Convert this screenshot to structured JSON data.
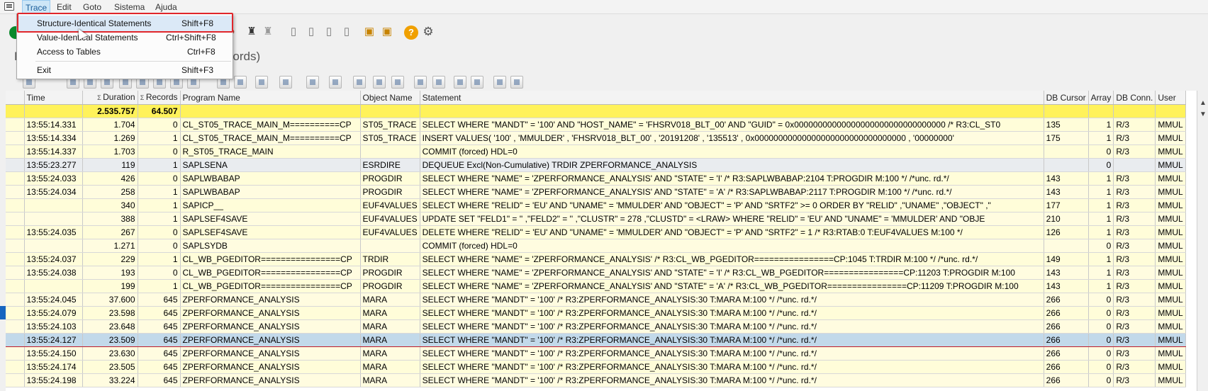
{
  "menubar": {
    "items": [
      "Trace",
      "Edit",
      "Goto",
      "Sistema",
      "Ajuda"
    ]
  },
  "dropdown": {
    "items": [
      {
        "label": "Structure-Identical Statements",
        "shortcut": "Shift+F8"
      },
      {
        "label": "Value-Identical Statements",
        "shortcut": "Ctrl+Shift+F8"
      },
      {
        "label": "Access to Tables",
        "shortcut": "Ctrl+F8"
      },
      {
        "label": "Exit",
        "shortcut": "Shift+F3"
      }
    ]
  },
  "page": {
    "subtitle_left": "P",
    "subtitle_right": "n Records)"
  },
  "toolbar": {
    "help_label": "?"
  },
  "grid": {
    "columns": [
      "Time",
      "Duration",
      "Records",
      "Program Name",
      "Object Name",
      "Statement",
      "DB Cursor",
      "Array",
      "DB Conn.",
      "User"
    ],
    "totals": {
      "duration": "2.535.757",
      "records": "64.507"
    },
    "rows": [
      {
        "time": "13:55:14.331",
        "duration": "1.704",
        "records": "0",
        "program": "CL_ST05_TRACE_MAIN_M==========CP",
        "object": "ST05_TRACE",
        "statement": "SELECT  WHERE \"MANDT\" = '100' AND \"HOST_NAME\" = 'FHSRV018_BLT_00' AND \"GUID\" = 0x00000000000000000000000000000000   /* R3:CL_ST0",
        "cursor": "135",
        "array": "1",
        "conn": "R/3",
        "user": "MMUL"
      },
      {
        "time": "13:55:14.334",
        "duration": "1.269",
        "records": "1",
        "program": "CL_ST05_TRACE_MAIN_M==========CP",
        "object": "ST05_TRACE",
        "statement": "INSERT  VALUES( '100' , 'MMULDER' , 'FHSRV018_BLT_00' , '20191208' , '135513' , 0x00000000000000000000000000000000 , '00000000'",
        "cursor": "175",
        "array": "1",
        "conn": "R/3",
        "user": "MMUL"
      },
      {
        "time": "13:55:14.337",
        "duration": "1.703",
        "records": "0",
        "program": "R_ST05_TRACE_MAIN",
        "object": "",
        "statement": "COMMIT (forced) HDL=0",
        "cursor": "",
        "array": "0",
        "conn": "R/3",
        "user": "MMUL"
      },
      {
        "time": "13:55:23.277",
        "duration": "119",
        "records": "1",
        "program": "SAPLSENA",
        "object": "ESRDIRE",
        "statement": "DEQUEUE Excl(Non-Cumulative) TRDIR ZPERFORMANCE_ANALYSIS",
        "cursor": "",
        "array": "0",
        "conn": "",
        "user": "MMUL"
      },
      {
        "time": "13:55:24.033",
        "duration": "426",
        "records": "0",
        "program": "SAPLWBABAP",
        "object": "PROGDIR",
        "statement": "SELECT  WHERE \"NAME\" = 'ZPERFORMANCE_ANALYSIS' AND \"STATE\" = 'I'   /* R3:SAPLWBABAP:2104 T:PROGDIR M:100 */  /*unc. rd.*/",
        "cursor": "143",
        "array": "1",
        "conn": "R/3",
        "user": "MMUL"
      },
      {
        "time": "13:55:24.034",
        "duration": "258",
        "records": "1",
        "program": "SAPLWBABAP",
        "object": "PROGDIR",
        "statement": "SELECT  WHERE \"NAME\" = 'ZPERFORMANCE_ANALYSIS' AND \"STATE\" = 'A'   /* R3:SAPLWBABAP:2117 T:PROGDIR M:100 */  /*unc. rd.*/",
        "cursor": "143",
        "array": "1",
        "conn": "R/3",
        "user": "MMUL"
      },
      {
        "time": "",
        "duration": "340",
        "records": "1",
        "program": "SAPICP__",
        "object": "EUF4VALUES",
        "statement": "SELECT  WHERE \"RELID\" = 'EU' AND \"UNAME\" = 'MMULDER' AND \"OBJECT\" = 'P' AND \"SRTF2\" >= 0  ORDER BY \"RELID\" ,\"UNAME\" ,\"OBJECT\" ,\"",
        "cursor": "177",
        "array": "1",
        "conn": "R/3",
        "user": "MMUL"
      },
      {
        "time": "",
        "duration": "388",
        "records": "1",
        "program": "SAPLSEF4SAVE",
        "object": "EUF4VALUES",
        "statement": "UPDATE  SET \"FELD1\" = '' ,\"FELD2\" = '' ,\"CLUSTR\" = 278 ,\"CLUSTD\" = <LRAW> WHERE \"RELID\" = 'EU' AND \"UNAME\" = 'MMULDER' AND \"OBJE",
        "cursor": "210",
        "array": "1",
        "conn": "R/3",
        "user": "MMUL"
      },
      {
        "time": "13:55:24.035",
        "duration": "267",
        "records": "0",
        "program": "SAPLSEF4SAVE",
        "object": "EUF4VALUES",
        "statement": "DELETE  WHERE \"RELID\" = 'EU' AND \"UNAME\" = 'MMULDER' AND \"OBJECT\" = 'P' AND \"SRTF2\" = 1   /* R3:RTAB:0 T:EUF4VALUES M:100 */",
        "cursor": "126",
        "array": "1",
        "conn": "R/3",
        "user": "MMUL"
      },
      {
        "time": "",
        "duration": "1.271",
        "records": "0",
        "program": "SAPLSYDB",
        "object": "",
        "statement": "COMMIT (forced) HDL=0",
        "cursor": "",
        "array": "0",
        "conn": "R/3",
        "user": "MMUL"
      },
      {
        "time": "13:55:24.037",
        "duration": "229",
        "records": "1",
        "program": "CL_WB_PGEDITOR================CP",
        "object": "TRDIR",
        "statement": "SELECT  WHERE \"NAME\" = 'ZPERFORMANCE_ANALYSIS'   /* R3:CL_WB_PGEDITOR================CP:1045 T:TRDIR M:100 */  /*unc. rd.*/",
        "cursor": "149",
        "array": "1",
        "conn": "R/3",
        "user": "MMUL"
      },
      {
        "time": "13:55:24.038",
        "duration": "193",
        "records": "0",
        "program": "CL_WB_PGEDITOR================CP",
        "object": "PROGDIR",
        "statement": "SELECT  WHERE \"NAME\" = 'ZPERFORMANCE_ANALYSIS' AND \"STATE\" = 'I'   /* R3:CL_WB_PGEDITOR================CP:11203 T:PROGDIR M:100",
        "cursor": "143",
        "array": "1",
        "conn": "R/3",
        "user": "MMUL"
      },
      {
        "time": "",
        "duration": "199",
        "records": "1",
        "program": "CL_WB_PGEDITOR================CP",
        "object": "PROGDIR",
        "statement": "SELECT  WHERE \"NAME\" = 'ZPERFORMANCE_ANALYSIS' AND \"STATE\" = 'A'   /* R3:CL_WB_PGEDITOR================CP:11209 T:PROGDIR M:100",
        "cursor": "143",
        "array": "1",
        "conn": "R/3",
        "user": "MMUL"
      },
      {
        "time": "13:55:24.045",
        "duration": "37.600",
        "records": "645",
        "program": "ZPERFORMANCE_ANALYSIS",
        "object": "MARA",
        "statement": "SELECT  WHERE \"MANDT\" = '100'   /* R3:ZPERFORMANCE_ANALYSIS:30 T:MARA M:100 */  /*unc. rd.*/",
        "cursor": "266",
        "array": "0",
        "conn": "R/3",
        "user": "MMUL"
      },
      {
        "time": "13:55:24.079",
        "duration": "23.598",
        "records": "645",
        "program": "ZPERFORMANCE_ANALYSIS",
        "object": "MARA",
        "statement": "SELECT  WHERE \"MANDT\" = '100'   /* R3:ZPERFORMANCE_ANALYSIS:30 T:MARA M:100 */  /*unc. rd.*/",
        "cursor": "266",
        "array": "0",
        "conn": "R/3",
        "user": "MMUL"
      },
      {
        "time": "13:55:24.103",
        "duration": "23.648",
        "records": "645",
        "program": "ZPERFORMANCE_ANALYSIS",
        "object": "MARA",
        "statement": "SELECT  WHERE \"MANDT\" = '100'   /* R3:ZPERFORMANCE_ANALYSIS:30 T:MARA M:100 */  /*unc. rd.*/",
        "cursor": "266",
        "array": "0",
        "conn": "R/3",
        "user": "MMUL"
      },
      {
        "time": "13:55:24.127",
        "duration": "23.509",
        "records": "645",
        "program": "ZPERFORMANCE_ANALYSIS",
        "object": "MARA",
        "statement": "SELECT  WHERE \"MANDT\" = '100'   /* R3:ZPERFORMANCE_ANALYSIS:30 T:MARA M:100 */  /*unc. rd.*/",
        "cursor": "266",
        "array": "0",
        "conn": "R/3",
        "user": "MMUL"
      },
      {
        "time": "13:55:24.150",
        "duration": "23.630",
        "records": "645",
        "program": "ZPERFORMANCE_ANALYSIS",
        "object": "MARA",
        "statement": "SELECT  WHERE \"MANDT\" = '100'   /* R3:ZPERFORMANCE_ANALYSIS:30 T:MARA M:100 */  /*unc. rd.*/",
        "cursor": "266",
        "array": "0",
        "conn": "R/3",
        "user": "MMUL"
      },
      {
        "time": "13:55:24.174",
        "duration": "23.505",
        "records": "645",
        "program": "ZPERFORMANCE_ANALYSIS",
        "object": "MARA",
        "statement": "SELECT  WHERE \"MANDT\" = '100'   /* R3:ZPERFORMANCE_ANALYSIS:30 T:MARA M:100 */  /*unc. rd.*/",
        "cursor": "266",
        "array": "0",
        "conn": "R/3",
        "user": "MMUL"
      },
      {
        "time": "13:55:24.198",
        "duration": "33.224",
        "records": "645",
        "program": "ZPERFORMANCE_ANALYSIS",
        "object": "MARA",
        "statement": "SELECT  WHERE \"MANDT\" = '100'   /* R3:ZPERFORMANCE_ANALYSIS:30 T:MARA M:100 */  /*unc. rd.*/",
        "cursor": "266",
        "array": "0",
        "conn": "R/3",
        "user": "MMUL"
      }
    ]
  }
}
